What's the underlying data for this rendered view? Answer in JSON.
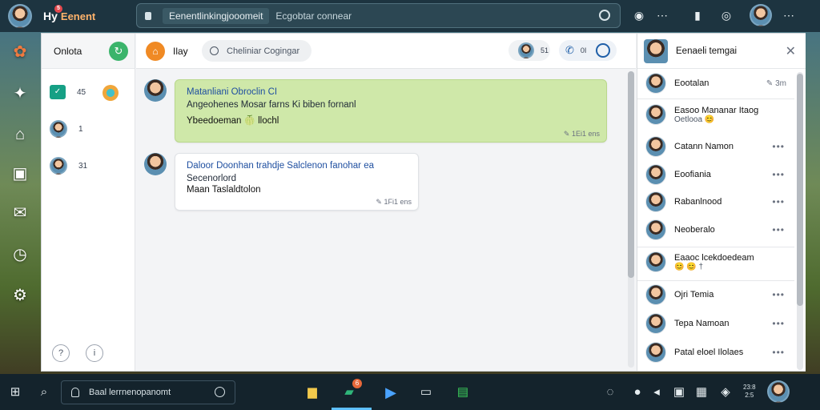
{
  "app": {
    "logo_text": "Hy",
    "logo_badge": "5",
    "name": "Eenent"
  },
  "address_bar": {
    "path": "Eenentlinkingjooomeit",
    "query": "Ecgobtar connear"
  },
  "rail": {
    "icons": [
      "flower-icon",
      "bookmark-star-icon",
      "inbox-icon",
      "folder-icon",
      "mail-icon",
      "clock-icon",
      "settings-icon"
    ]
  },
  "sidebar": {
    "title": "Onlota",
    "items": [
      {
        "count": "45"
      },
      {
        "count": "1"
      },
      {
        "count": "31"
      }
    ]
  },
  "chat": {
    "channel": "Ilay",
    "search_placeholder": "Cheliniar Cogingar",
    "members_count": "51",
    "call_count": "0I",
    "messages": [
      {
        "sender": "Matanliani Obroclin CI",
        "line1": "Angeohenes Mosar farns Ki biben fornanl",
        "line2": "Ybeedoeman 🍈 llochl",
        "time": "1Ei1 ens"
      },
      {
        "sender": "Daloor Doonhan trahdje Salclenon fanohar ea",
        "line1": "Secenorlord",
        "line2": "Maan Taslaldtolon",
        "time": "1Fi1 ens"
      }
    ]
  },
  "right_panel": {
    "title": "Eenaeli temgai",
    "contacts": [
      {
        "name": "Eootalan",
        "meta": "3m"
      },
      {
        "name": "Easoo Mananar Itaog",
        "sub": "Oetlooa 😊"
      },
      {
        "name": "Catann Namon"
      },
      {
        "name": "Eoofiania"
      },
      {
        "name": "Rabanlnood"
      },
      {
        "name": "Neoberalo"
      },
      {
        "name": "Eaaoc lcekdoedeam",
        "sub": "😊 😊 †"
      },
      {
        "name": "Ojri Temia"
      },
      {
        "name": "Tepa Namoan"
      },
      {
        "name": "Patal eloel Ilolaes"
      }
    ]
  },
  "taskbar": {
    "search_text": "Baal lerrnenopanomt",
    "chat_badge": "6",
    "time": "23:8",
    "date": "2:5"
  }
}
